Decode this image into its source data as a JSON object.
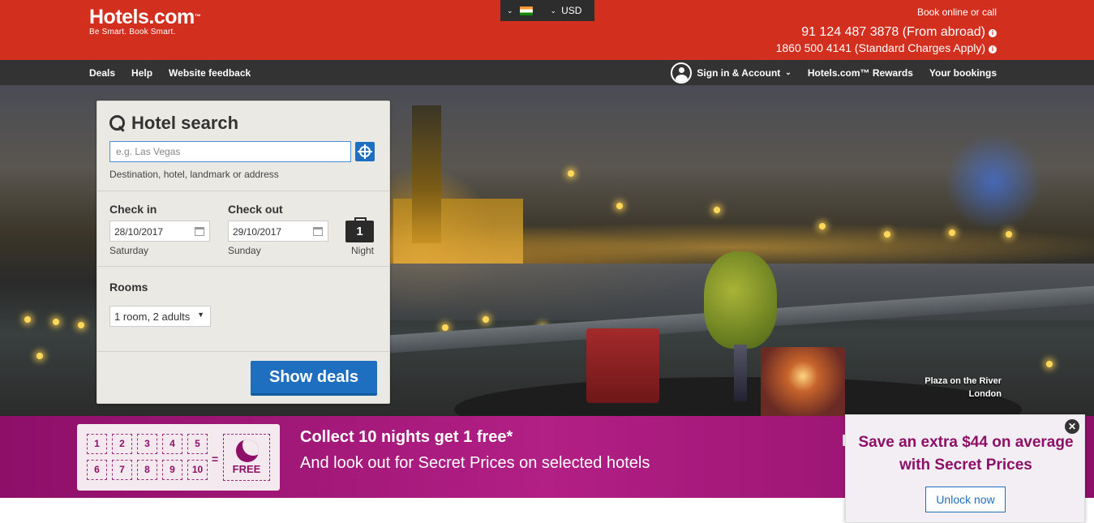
{
  "header": {
    "logo_text": "Hotels.com",
    "logo_tm": "™",
    "tagline": "Be Smart. Book Smart.",
    "locale": {
      "flag": "india-flag-icon",
      "currency": "USD"
    },
    "contact": {
      "book_label": "Book online or call",
      "phone_abroad": "91 124 487 3878 (From abroad)",
      "phone_standard": "1860 500 4141 (Standard Charges Apply)"
    },
    "colors": {
      "brand_red": "#d32f1e",
      "nav_bg": "#333333"
    }
  },
  "nav": {
    "left": [
      "Deals",
      "Help",
      "Website feedback"
    ],
    "signin": "Sign in & Account",
    "rewards": "Hotels.com™ Rewards",
    "bookings": "Your bookings"
  },
  "search": {
    "title": "Hotel search",
    "destination_placeholder": "e.g. Las Vegas",
    "destination_value": "",
    "destination_help": "Destination, hotel, landmark or address",
    "checkin_label": "Check in",
    "checkin_value": "28/10/2017",
    "checkin_day": "Saturday",
    "checkout_label": "Check out",
    "checkout_value": "29/10/2017",
    "checkout_day": "Sunday",
    "nights_count": "1",
    "nights_label": "Night",
    "rooms_label": "Rooms",
    "rooms_value": "1 room, 2 adults",
    "submit_label": "Show deals",
    "colors": {
      "button_blue": "#1f6fc0"
    }
  },
  "hero": {
    "caption_line1": "Plaza on the River",
    "caption_line2": "London"
  },
  "promo": {
    "numbers": [
      "1",
      "2",
      "3",
      "4",
      "5",
      "6",
      "7",
      "8",
      "9",
      "10"
    ],
    "equals": "=",
    "free_label": "FREE",
    "title": "Collect 10 nights get 1 free*",
    "subtitle": "And look out for Secret Prices on selected hotels",
    "partial_text": "H",
    "colors": {
      "promo_purple": "#8d0f68"
    }
  },
  "popup": {
    "close": "✕",
    "message": "Save an extra $44 on average with Secret Prices",
    "button_label": "Unlock now"
  }
}
